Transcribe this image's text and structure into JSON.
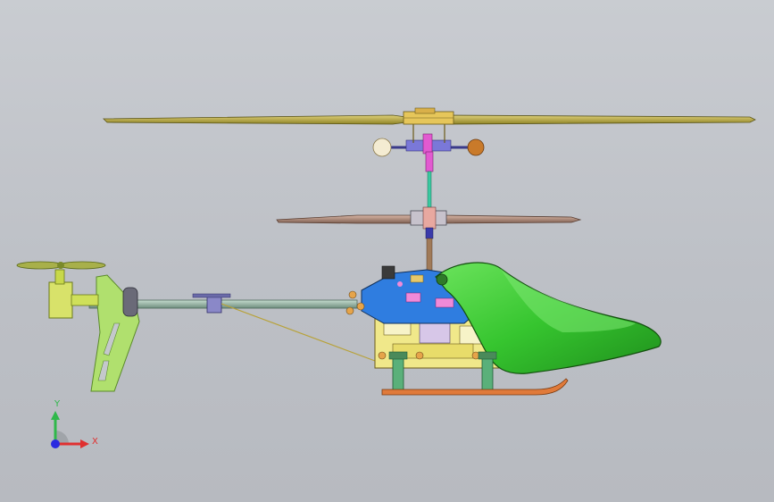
{
  "viewport": {
    "background_top": "#c9ccd1",
    "background_bottom": "#b7bac0"
  },
  "triad": {
    "x_label": "X",
    "y_label": "Y",
    "x_color": "#e03030",
    "y_color": "#2fb84a",
    "z_color": "#2a2ae0"
  },
  "model": {
    "main_rotor_color": "#b5a53a",
    "lower_rotor_color": "#b08a7a",
    "canopy_color": "#3fc63a",
    "frame_color": "#f2ec8c",
    "side_plate_color": "#2f7de0",
    "tail_fin_color": "#a8e06a",
    "boom_color": "#8eb0a0",
    "skid_color": "#e07a3a",
    "flybar_weight_color": "#f3ead0",
    "shaft_color": "#3ac8a0"
  }
}
